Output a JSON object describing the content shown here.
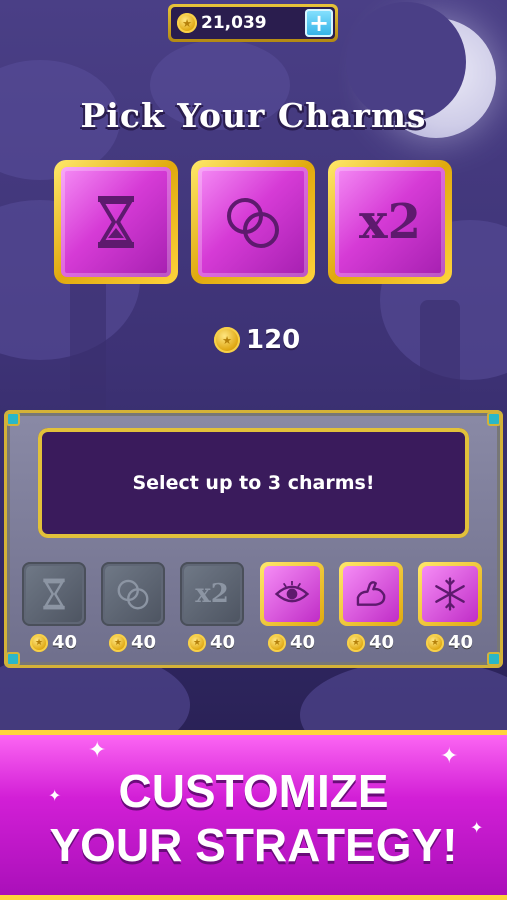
{
  "header": {
    "coin_balance": "21,039",
    "add_coins_label": "+"
  },
  "title": "Pick Your Charms",
  "selected_charms": [
    {
      "name": "hourglass-icon"
    },
    {
      "name": "rings-icon"
    },
    {
      "name": "multiplier-x2",
      "label": "x2"
    }
  ],
  "total_cost": "120",
  "panel": {
    "message": "Select up to 3 charms!",
    "charms": [
      {
        "icon": "hourglass-icon",
        "cost": "40",
        "state": "used"
      },
      {
        "icon": "rings-icon",
        "cost": "40",
        "state": "used"
      },
      {
        "icon": "multiplier-x2",
        "label": "x2",
        "cost": "40",
        "state": "used"
      },
      {
        "icon": "eye-icon",
        "cost": "40",
        "state": "available"
      },
      {
        "icon": "flexed-arm-icon",
        "cost": "40",
        "state": "available"
      },
      {
        "icon": "snowflake-icon",
        "cost": "40",
        "state": "available"
      }
    ]
  },
  "banner": {
    "line1": "CUSTOMIZE",
    "line2": "YOUR STRATEGY!"
  },
  "colors": {
    "gem_pink": "#d63bd6",
    "gold": "#e0a90e",
    "panel_gray": "#7c7c98",
    "message_bg": "#3a1b5c"
  }
}
